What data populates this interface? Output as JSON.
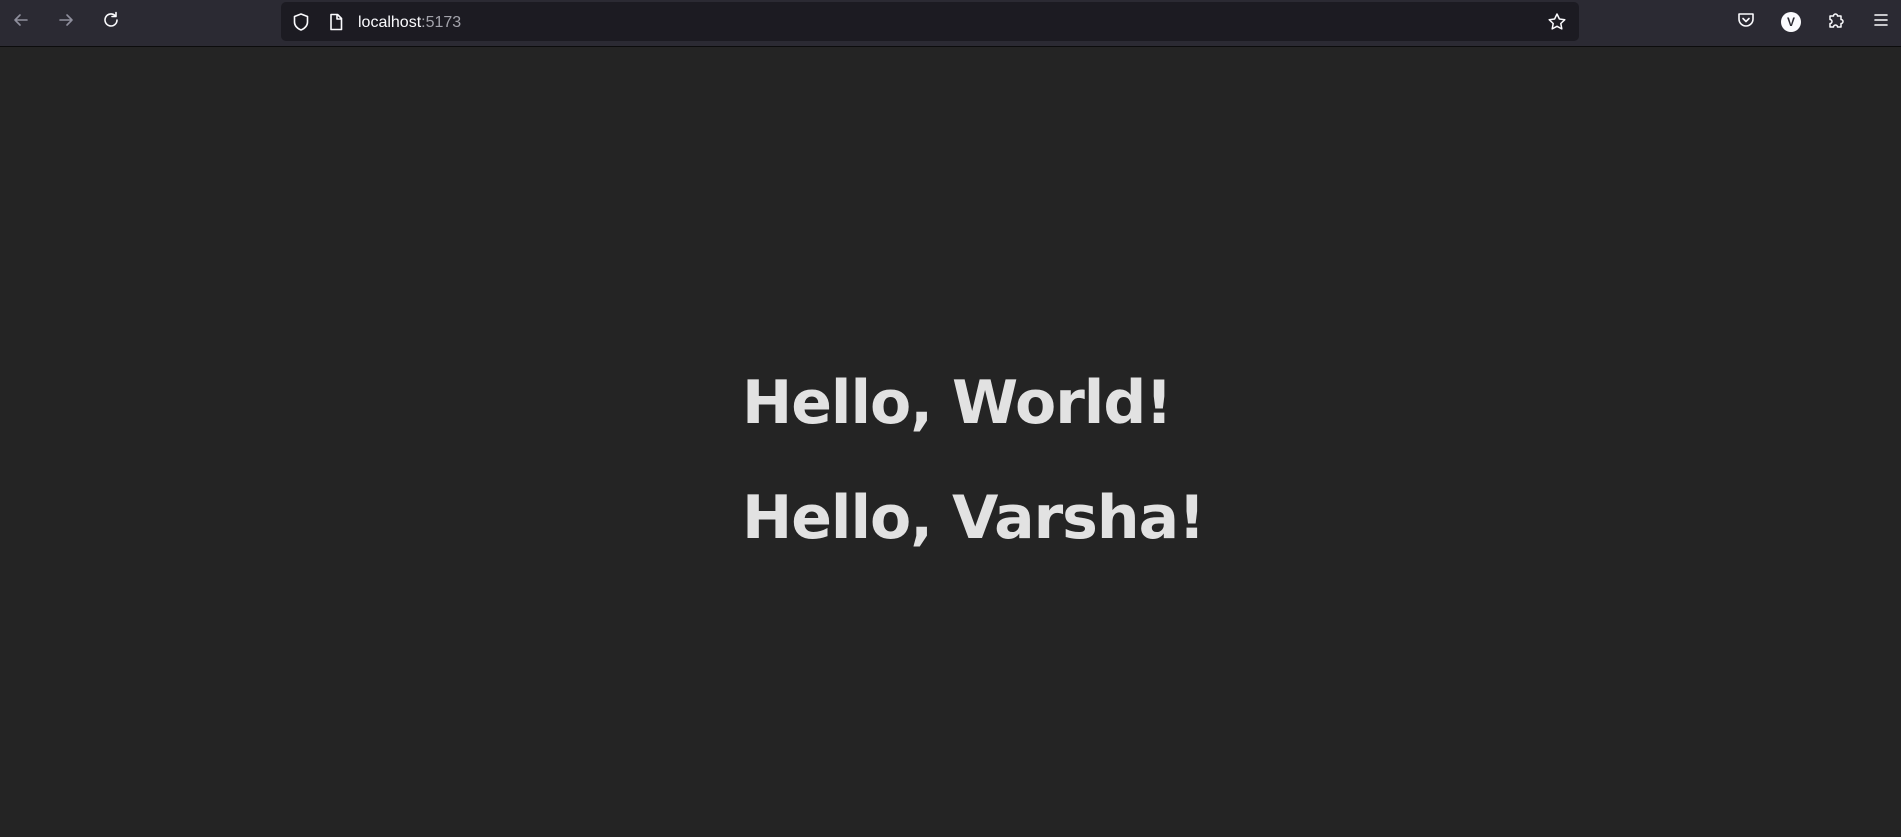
{
  "browser": {
    "url_host": "localhost",
    "url_port": ":5173",
    "profile_initial": "V",
    "icons": {
      "back": "arrow-left-icon",
      "forward": "arrow-right-icon",
      "reload": "reload-icon",
      "tracking_protection": "shield-icon",
      "page_info": "page-icon",
      "bookmark": "star-icon",
      "pocket": "pocket-icon",
      "account": "avatar-icon",
      "extensions": "puzzle-icon",
      "menu": "hamburger-icon"
    }
  },
  "page": {
    "greetings": [
      {
        "text": "Hello, World!"
      },
      {
        "text": "Hello, Varsha!"
      }
    ]
  },
  "colors": {
    "toolbar_bg": "#2b2a33",
    "urlbar_bg": "#1c1b22",
    "page_bg": "#242424",
    "heading_text": "#e5e5e5"
  }
}
